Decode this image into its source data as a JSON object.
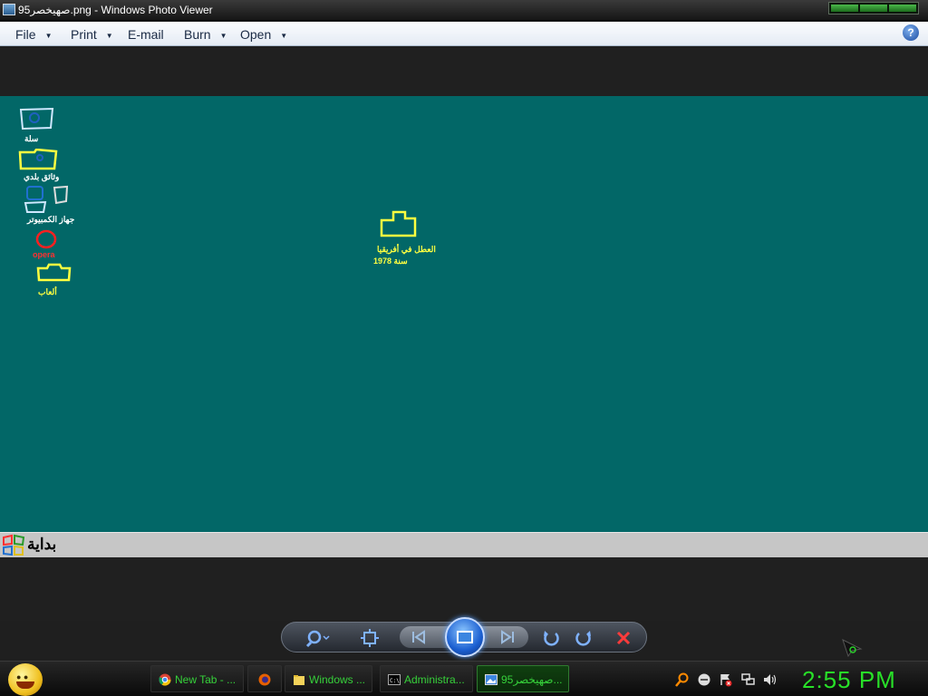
{
  "window": {
    "title": "صهيخصر95.png - Windows Photo Viewer"
  },
  "menu": {
    "items": [
      {
        "label": "File",
        "has_arrow": true
      },
      {
        "label": "Print",
        "has_arrow": true
      },
      {
        "label": "E-mail",
        "has_arrow": false
      },
      {
        "label": "Burn",
        "has_arrow": true
      },
      {
        "label": "Open",
        "has_arrow": true
      }
    ],
    "help_label": "?"
  },
  "image": {
    "desktop_color": "#026767",
    "icons": [
      {
        "name": "recycle-bin-icon",
        "label": "سلة",
        "color": "#ffffff"
      },
      {
        "name": "my-documents-icon",
        "label": "وثائق بلدي",
        "color": "#ffffff"
      },
      {
        "name": "my-computer-icon",
        "label": "جهاز الكمبيوتر",
        "color": "#ffffff"
      },
      {
        "name": "opera-icon",
        "label": "opera",
        "color": "#ff3030"
      },
      {
        "name": "games-folder-icon",
        "label": "ألعاب",
        "color": "#ffff40"
      },
      {
        "name": "africa-folder-icon",
        "label_line1": "العطل في أفريقيا",
        "label_line2": "سنة 1978",
        "color": "#ffff40"
      }
    ],
    "start_label": "بداية"
  },
  "controls": {
    "zoom_icon": "magnifier-icon",
    "fit_icon": "actual-size-icon",
    "prev_icon": "previous-icon",
    "slideshow_icon": "slideshow-icon",
    "next_icon": "next-icon",
    "rotate_ccw_icon": "rotate-counterclockwise-icon",
    "rotate_cw_icon": "rotate-clockwise-icon",
    "delete_icon": "delete-icon"
  },
  "taskbar": {
    "tasks": [
      {
        "label": "New Tab - ...",
        "icon": "chrome-icon",
        "active": false
      },
      {
        "label": "",
        "icon": "firefox-icon",
        "active": false
      },
      {
        "label": "Windows ...",
        "icon": "folder-icon",
        "active": false
      },
      {
        "label": "Administra...",
        "icon": "cmd-icon",
        "active": false
      },
      {
        "label": "صهيخصر95...",
        "icon": "photo-viewer-icon",
        "active": true
      }
    ],
    "clock": "2:55 PM"
  }
}
